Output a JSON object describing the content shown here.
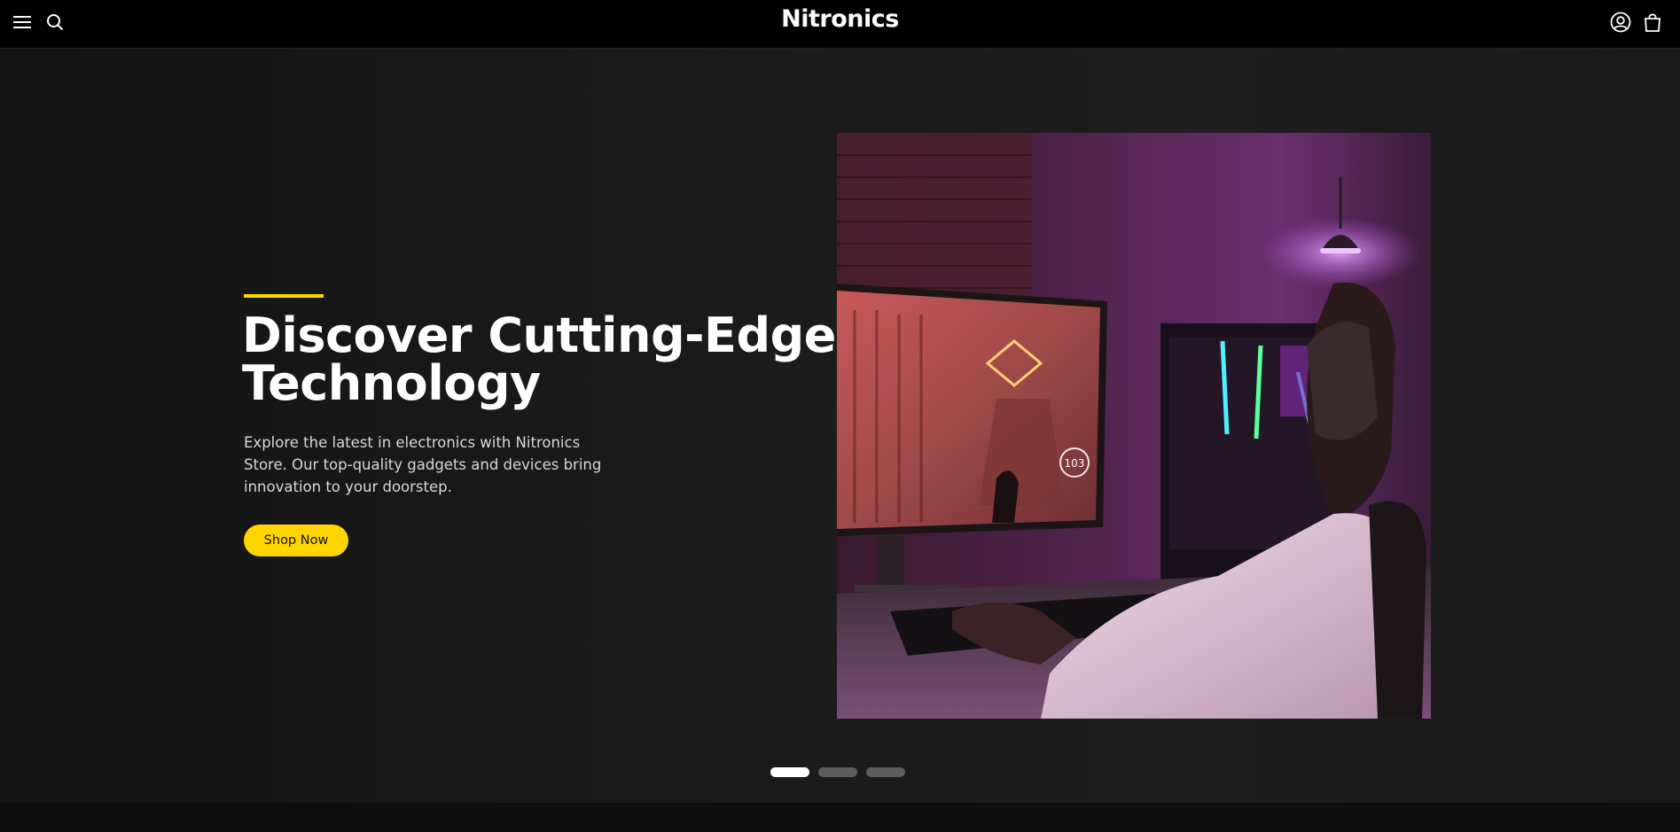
{
  "header": {
    "brand": "Nitronics",
    "icons": {
      "menu": "menu-icon",
      "search": "search-icon",
      "account": "account-icon",
      "cart": "cart-icon"
    }
  },
  "hero": {
    "headline": "Discover Cutting-Edge Technology",
    "subtext": "Explore the latest in electronics with Nitronics Store. Our top-quality gadgets and devices bring innovation to your doorstep.",
    "cta_label": "Shop Now",
    "accent_color": "#ffd500",
    "image_alt": "",
    "hud": {
      "speed": "103",
      "labels": []
    }
  },
  "carousel": {
    "slides": 3,
    "active_index": 0
  },
  "colors": {
    "background": "#161616",
    "header": "#000000",
    "accent": "#ffd500",
    "dot_active": "#ffffff",
    "dot_inactive": "#5c5c5c"
  }
}
